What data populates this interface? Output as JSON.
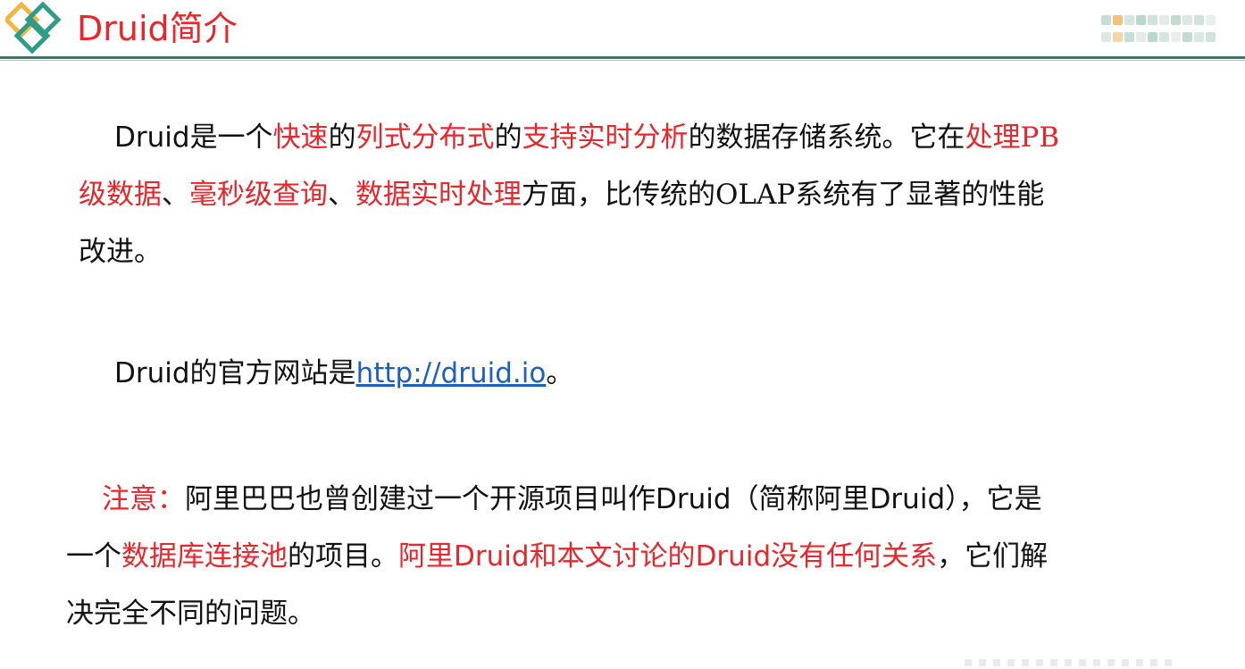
{
  "header": {
    "title": "Druid简介",
    "accent": "#e8262b",
    "rule_color": "#2e7d6b"
  },
  "paragraph1": {
    "line1": [
      {
        "t": "Druid",
        "style": "sans"
      },
      {
        "t": "是一个",
        "style": "plain"
      },
      {
        "t": "快速",
        "style": "red"
      },
      {
        "t": "的",
        "style": "plain"
      },
      {
        "t": "列式分布式",
        "style": "red"
      },
      {
        "t": "的",
        "style": "plain"
      },
      {
        "t": "支持实时分析",
        "style": "red"
      },
      {
        "t": "的数据存储系统。它在",
        "style": "plain"
      },
      {
        "t": "处理PB",
        "style": "red"
      }
    ],
    "line2": [
      {
        "t": "级数据",
        "style": "red"
      },
      {
        "t": "、",
        "style": "plain"
      },
      {
        "t": "毫秒级查询",
        "style": "red"
      },
      {
        "t": "、",
        "style": "plain"
      },
      {
        "t": "数据实时处理",
        "style": "red"
      },
      {
        "t": "方面，比传统的OLAP系统有了显著的性能",
        "style": "plain"
      }
    ],
    "line3": [
      {
        "t": "改进。",
        "style": "plain"
      }
    ]
  },
  "paragraph2": {
    "prefix": "Druid的官方网站是",
    "link_text": "http://druid.io",
    "suffix": "。"
  },
  "paragraph3": {
    "line1": [
      {
        "t": "注意：",
        "style": "red"
      },
      {
        "t": "阿里巴巴也曾创建过一个开源项目叫作",
        "style": "plain"
      },
      {
        "t": "Druid",
        "style": "sans"
      },
      {
        "t": "（简称阿里",
        "style": "plain"
      },
      {
        "t": "Druid",
        "style": "sans"
      },
      {
        "t": "），它是",
        "style": "plain"
      }
    ],
    "line2": [
      {
        "t": "一个",
        "style": "plain"
      },
      {
        "t": "数据库连接池",
        "style": "red"
      },
      {
        "t": "的项目。",
        "style": "plain"
      },
      {
        "t": "阿里",
        "style": "red"
      },
      {
        "t": "Druid",
        "style": "red sans"
      },
      {
        "t": "和本文讨论的",
        "style": "red"
      },
      {
        "t": "Druid",
        "style": "red sans"
      },
      {
        "t": "没有任何关系",
        "style": "red"
      },
      {
        "t": "，它们解",
        "style": "plain"
      }
    ],
    "line3": [
      {
        "t": "决完全不同的问题。",
        "style": "plain"
      }
    ]
  }
}
